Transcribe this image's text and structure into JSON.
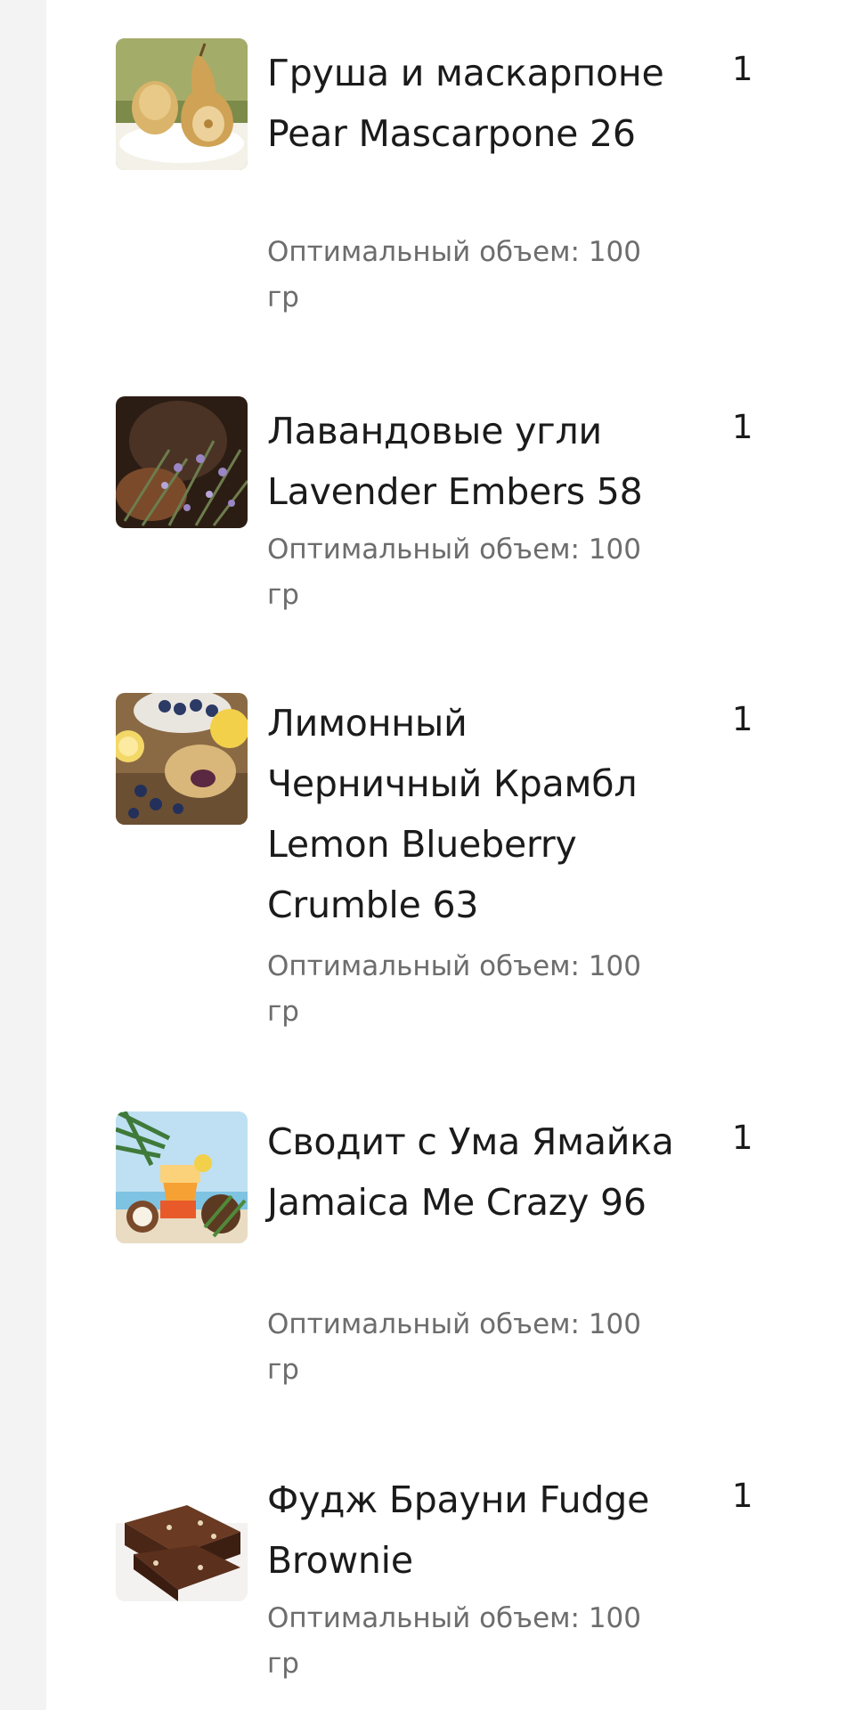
{
  "items": [
    {
      "name": "Груша и маскарпоне Pear Mascarpone 26",
      "volume": "Оптимальный объем: 100 гр",
      "qty": "1",
      "image_icon": "pear-mascarpone-image"
    },
    {
      "name": "Лавандовые угли Lavender Embers 58",
      "volume": "Оптимальный объем: 100 гр",
      "qty": "1",
      "image_icon": "lavender-embers-image"
    },
    {
      "name": "Лимонный Черничный Крамбл Lemon Blueberry Crumble 63",
      "volume": "Оптимальный объем: 100 гр",
      "qty": "1",
      "image_icon": "lemon-blueberry-crumble-image"
    },
    {
      "name": "Сводит с Ума Ямайка Jamaica Me Crazy 96",
      "volume": "Оптимальный объем: 100 гр",
      "qty": "1",
      "image_icon": "jamaica-cocktail-image"
    },
    {
      "name": "Фудж Брауни Fudge Brownie",
      "volume": "Оптимальный объем: 100 гр",
      "qty": "1",
      "image_icon": "fudge-brownie-image"
    }
  ]
}
